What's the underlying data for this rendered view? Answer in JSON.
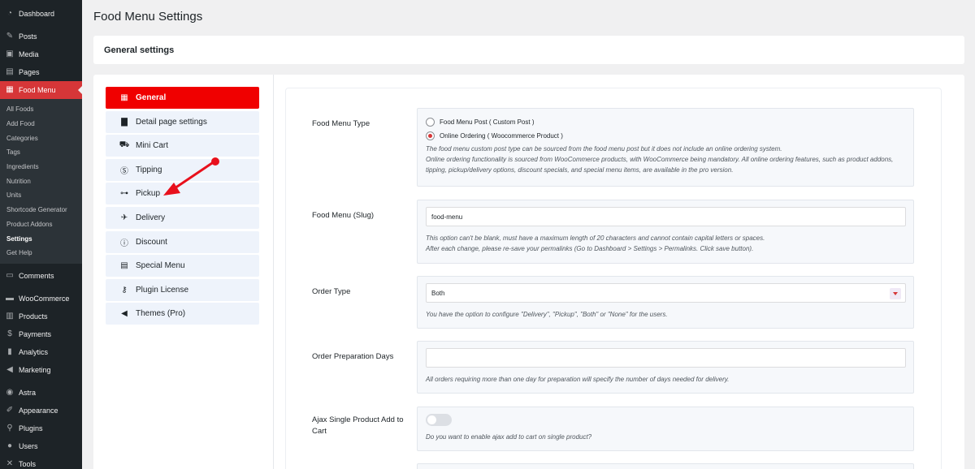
{
  "sidebar": {
    "top_items": [
      {
        "label": "Dashboard",
        "icon": "dashboard-icon"
      },
      {
        "label": "Posts",
        "icon": "pin-icon"
      },
      {
        "label": "Media",
        "icon": "media-icon"
      },
      {
        "label": "Pages",
        "icon": "pages-icon"
      },
      {
        "label": "Food Menu",
        "icon": "food-menu-icon"
      }
    ],
    "food_menu_sub": [
      "All Foods",
      "Add Food",
      "Categories",
      "Tags",
      "Ingredients",
      "Nutrition",
      "Units",
      "Shortcode Generator",
      "Product Addons",
      "Settings",
      "Get Help"
    ],
    "bottom_items": [
      {
        "label": "Comments",
        "icon": "comments-icon"
      },
      {
        "label": "WooCommerce",
        "icon": "woocommerce-icon"
      },
      {
        "label": "Products",
        "icon": "products-icon"
      },
      {
        "label": "Payments",
        "icon": "payments-icon"
      },
      {
        "label": "Analytics",
        "icon": "analytics-icon"
      },
      {
        "label": "Marketing",
        "icon": "marketing-icon"
      },
      {
        "label": "Astra",
        "icon": "astra-icon"
      },
      {
        "label": "Appearance",
        "icon": "appearance-icon"
      },
      {
        "label": "Plugins",
        "icon": "plugins-icon"
      },
      {
        "label": "Users",
        "icon": "users-icon"
      },
      {
        "label": "Tools",
        "icon": "tools-icon"
      }
    ]
  },
  "page": {
    "title": "Food Menu Settings",
    "section_title": "General settings"
  },
  "tabs": [
    {
      "label": "General",
      "icon": "grid-icon"
    },
    {
      "label": "Detail page settings",
      "icon": "document-icon"
    },
    {
      "label": "Mini Cart",
      "icon": "cart-icon"
    },
    {
      "label": "Tipping",
      "icon": "dollar-icon"
    },
    {
      "label": "Pickup",
      "icon": "car-icon"
    },
    {
      "label": "Delivery",
      "icon": "plane-icon"
    },
    {
      "label": "Discount",
      "icon": "info-icon"
    },
    {
      "label": "Special Menu",
      "icon": "table-icon"
    },
    {
      "label": "Plugin License",
      "icon": "key-icon"
    },
    {
      "label": "Themes (Pro)",
      "icon": "megaphone-icon"
    }
  ],
  "settings": {
    "food_menu_type": {
      "label": "Food Menu Type",
      "option1": "Food Menu Post ( Custom Post )",
      "option2": "Online Ordering ( Woocommerce Product )",
      "desc1": "The food menu custom post type can be sourced from the food menu post but it does not include an online ordering system.",
      "desc2": "Online ordering functionality is sourced from WooCommerce products, with WooCommerce being mandatory. All online ordering features, such as product addons, tipping, pickup/delivery options, discount specials, and special menu items, are available in the pro version."
    },
    "slug": {
      "label": "Food Menu (Slug)",
      "value": "food-menu",
      "desc1": "This option can't be blank, must have a maximum length of 20 characters and cannot contain capital letters or spaces.",
      "desc2": "After each change, please re-save your permalinks (Go to Dashboard > Settings > Permalinks. Click save button)."
    },
    "order_type": {
      "label": "Order Type",
      "value": "Both",
      "desc": "You have the option to configure \"Delivery\", \"Pickup\", \"Both\" or \"None\" for the users."
    },
    "prep_days": {
      "label": "Order Preparation Days",
      "value": "",
      "desc": "All orders requiring more than one day for preparation will specify the number of days needed for delivery."
    },
    "ajax": {
      "label": "Ajax Single Product Add to Cart",
      "desc": "Do you want to enable ajax add to cart on single product?"
    }
  },
  "colors": {
    "accent": "#f00000",
    "wp_active": "#d63638",
    "arrow": "#e8101c"
  }
}
